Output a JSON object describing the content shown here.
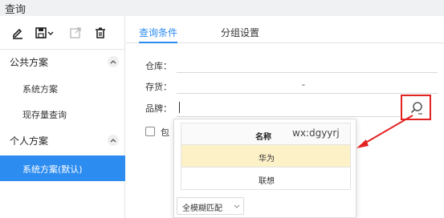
{
  "window": {
    "title": "查询"
  },
  "toolbar": {
    "edit_icon": "pencil-icon",
    "save_icon": "save-icon",
    "export_icon": "export-icon",
    "delete_icon": "trash-icon"
  },
  "sidebar": {
    "public_section": {
      "label": "公共方案",
      "items": [
        "系统方案",
        "现存量查询"
      ]
    },
    "personal_section": {
      "label": "个人方案",
      "items": [
        "系统方案(默认)"
      ]
    }
  },
  "tabs": [
    "查询条件",
    "分组设置"
  ],
  "form": {
    "warehouse_label": "仓库：",
    "inventory_label": "存货：",
    "inventory_separator": "-",
    "brand_label": "品牌：",
    "checkbox_label": "包"
  },
  "dropdown": {
    "column_header": "名称",
    "watermark": "wx:dgyyrj",
    "rows": [
      "华为",
      "联想"
    ],
    "match_mode": "全模糊匹配"
  },
  "colors": {
    "accent": "#2d8cf0",
    "highlight_row": "#fdf1c8",
    "annotation_red": "#e32222"
  }
}
